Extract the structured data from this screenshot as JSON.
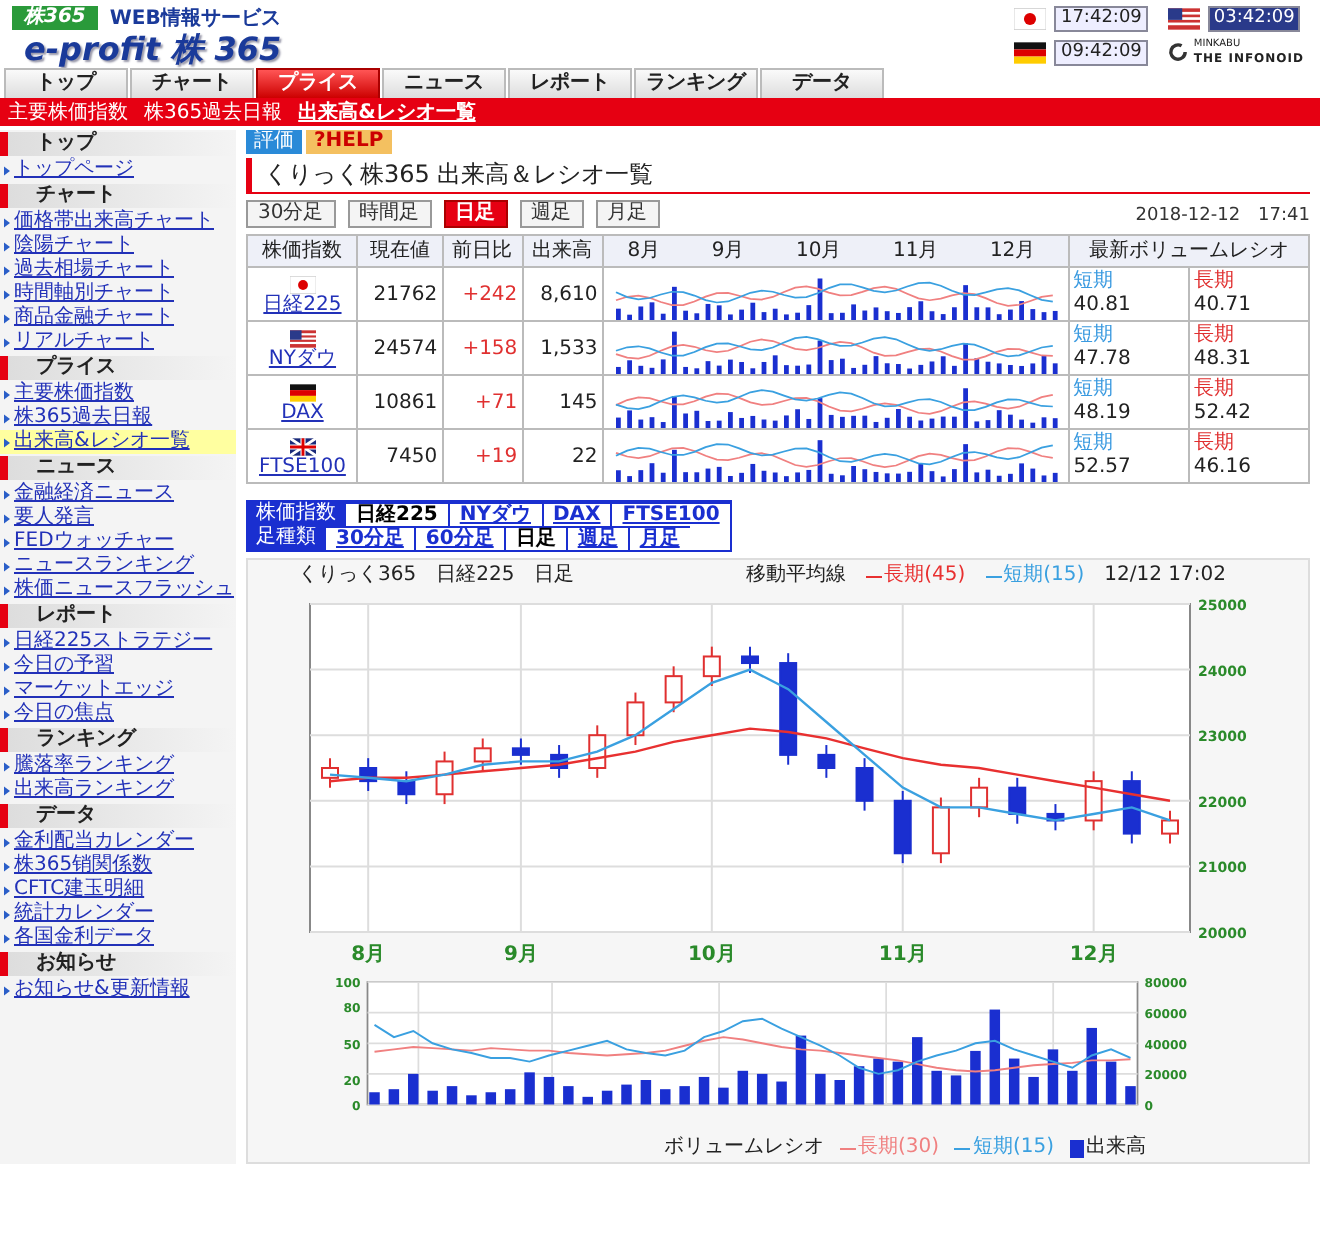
{
  "header": {
    "badge": "株365",
    "service": "WEB情報サービス",
    "logo": "e-profit 株 365",
    "clocks": [
      {
        "kind": "jp",
        "time": "17:42:09",
        "highlighted": false
      },
      {
        "kind": "us",
        "time": "03:42:09",
        "highlighted": true
      },
      {
        "kind": "de",
        "time": "09:42:09",
        "highlighted": false
      }
    ],
    "partner": {
      "small": "MINKABU",
      "name": "THE INFONOID"
    }
  },
  "nav": [
    {
      "label": "トップ",
      "selected": false
    },
    {
      "label": "チャート",
      "selected": false
    },
    {
      "label": "プライス",
      "selected": true
    },
    {
      "label": "ニュース",
      "selected": false
    },
    {
      "label": "レポート",
      "selected": false
    },
    {
      "label": "ランキング",
      "selected": false
    },
    {
      "label": "データ",
      "selected": false
    }
  ],
  "subnav": [
    {
      "label": "主要株価指数",
      "selected": false
    },
    {
      "label": "株365過去日報",
      "selected": false
    },
    {
      "label": "出来高&レシオ一覧",
      "selected": true
    }
  ],
  "sidebar": [
    {
      "title": "トップ",
      "items": [
        {
          "label": "トップページ",
          "selected": false
        }
      ]
    },
    {
      "title": "チャート",
      "items": [
        {
          "label": "価格帯出来高チャート",
          "selected": false
        },
        {
          "label": "陰陽チャート",
          "selected": false
        },
        {
          "label": "過去相場チャート",
          "selected": false
        },
        {
          "label": "時間軸別チャート",
          "selected": false
        },
        {
          "label": "商品金融チャート",
          "selected": false
        },
        {
          "label": "リアルチャート",
          "selected": false
        }
      ]
    },
    {
      "title": "プライス",
      "items": [
        {
          "label": "主要株価指数",
          "selected": false
        },
        {
          "label": "株365過去日報",
          "selected": false
        },
        {
          "label": "出来高&レシオ一覧",
          "selected": true
        }
      ]
    },
    {
      "title": "ニュース",
      "items": [
        {
          "label": "金融経済ニュース",
          "selected": false
        },
        {
          "label": "要人発言",
          "selected": false
        },
        {
          "label": "FEDウォッチャー",
          "selected": false
        },
        {
          "label": "ニュースランキング",
          "selected": false
        },
        {
          "label": "株価ニュースフラッシュ",
          "selected": false
        }
      ]
    },
    {
      "title": "レポート",
      "items": [
        {
          "label": "日経225ストラテジー",
          "selected": false
        },
        {
          "label": "今日の予習",
          "selected": false
        },
        {
          "label": "マーケットエッジ",
          "selected": false
        },
        {
          "label": "今日の焦点",
          "selected": false
        }
      ]
    },
    {
      "title": "ランキング",
      "items": [
        {
          "label": "騰落率ランキング",
          "selected": false
        },
        {
          "label": "出来高ランキング",
          "selected": false
        }
      ]
    },
    {
      "title": "データ",
      "items": [
        {
          "label": "金利配当カレンダー",
          "selected": false
        },
        {
          "label": "株365销関係数",
          "selected": false
        },
        {
          "label": "CFTC建玉明細",
          "selected": false
        },
        {
          "label": "統計カレンダー",
          "selected": false
        },
        {
          "label": "各国金利データ",
          "selected": false
        }
      ]
    },
    {
      "title": "お知らせ",
      "items": [
        {
          "label": "お知らせ&更新情報",
          "selected": false
        }
      ]
    }
  ],
  "tools": [
    {
      "label": "評価",
      "kind": "rate"
    },
    {
      "label": "?HELP",
      "kind": "help"
    }
  ],
  "title": "くりっく株365 出来高＆レシオ一覧",
  "periods": [
    {
      "label": "30分足",
      "selected": false
    },
    {
      "label": "時間足",
      "selected": false
    },
    {
      "label": "日足",
      "selected": true
    },
    {
      "label": "週足",
      "selected": false
    },
    {
      "label": "月足",
      "selected": false
    }
  ],
  "timestamp": "2018-12-12　17:41",
  "table": {
    "columns": [
      "株価指数",
      "現在値",
      "前日比",
      "出来高",
      "最新ボリュームレシオ"
    ],
    "months": [
      "8月",
      "9月",
      "10月",
      "11月",
      "12月"
    ],
    "rows": [
      {
        "kind": "jp",
        "name": "日経225",
        "price": "21762",
        "change": "+242",
        "volume": "8,610",
        "short_label": "短期",
        "short": "40.81",
        "long_label": "長期",
        "long": "40.71"
      },
      {
        "kind": "us",
        "name": "NYダウ",
        "price": "24574",
        "change": "+158",
        "volume": "1,533",
        "short_label": "短期",
        "short": "47.78",
        "long_label": "長期",
        "long": "48.31"
      },
      {
        "kind": "de",
        "name": "DAX",
        "price": "10861",
        "change": "+71",
        "volume": "145",
        "short_label": "短期",
        "short": "48.19",
        "long_label": "長期",
        "long": "52.42"
      },
      {
        "kind": "uk",
        "name": "FTSE100",
        "price": "7450",
        "change": "+19",
        "volume": "22",
        "short_label": "短期",
        "short": "52.57",
        "long_label": "長期",
        "long": "46.16"
      }
    ]
  },
  "selector": [
    {
      "label": "株価指数",
      "options": [
        {
          "label": "日経225",
          "selected": true
        },
        {
          "label": "NYダウ",
          "selected": false
        },
        {
          "label": "DAX",
          "selected": false
        },
        {
          "label": "FTSE100",
          "selected": false
        }
      ]
    },
    {
      "label": "足種類",
      "options": [
        {
          "label": "30分足",
          "selected": false
        },
        {
          "label": "60分足",
          "selected": false
        },
        {
          "label": "日足",
          "selected": true
        },
        {
          "label": "週足",
          "selected": false
        },
        {
          "label": "月足",
          "selected": false
        }
      ]
    }
  ],
  "chart_header": {
    "source": "くりっく365",
    "index": "日経225",
    "period": "日足",
    "ma_label": "移動平均線",
    "time": "12/12 17:02"
  },
  "price_chart": {
    "chart_data": {
      "type": "candlestick",
      "grid": true,
      "categories": [
        null,
        "8月",
        null,
        null,
        null,
        "9月",
        null,
        null,
        null,
        null,
        "10月",
        null,
        null,
        null,
        null,
        "11月",
        null,
        null,
        null,
        null,
        "12月",
        null,
        null
      ],
      "ylim": [
        20000,
        25000
      ],
      "yticks": [
        25000,
        24000,
        23000,
        22000,
        21000,
        20000
      ],
      "ohlc": [
        [
          22350,
          22650,
          22200,
          22500
        ],
        [
          22500,
          22650,
          22150,
          22300
        ],
        [
          22300,
          22450,
          21950,
          22100
        ],
        [
          22100,
          22750,
          21950,
          22600
        ],
        [
          22600,
          22950,
          22450,
          22800
        ],
        [
          22800,
          22950,
          22550,
          22700
        ],
        [
          22700,
          22850,
          22350,
          22500
        ],
        [
          22500,
          23150,
          22350,
          23000
        ],
        [
          23000,
          23650,
          22850,
          23500
        ],
        [
          23500,
          24050,
          23350,
          23900
        ],
        [
          23900,
          24350,
          23750,
          24200
        ],
        [
          24200,
          24350,
          23950,
          24100
        ],
        [
          24100,
          24250,
          22550,
          22700
        ],
        [
          22700,
          22850,
          22350,
          22500
        ],
        [
          22500,
          22650,
          21850,
          22000
        ],
        [
          22000,
          22150,
          21050,
          21200
        ],
        [
          21200,
          22050,
          21050,
          21900
        ],
        [
          21900,
          22350,
          21750,
          22200
        ],
        [
          22200,
          22350,
          21650,
          21800
        ],
        [
          21800,
          21950,
          21550,
          21700
        ],
        [
          21700,
          22450,
          21550,
          22300
        ],
        [
          22300,
          22450,
          21350,
          21500
        ],
        [
          21500,
          21850,
          21350,
          21700
        ]
      ],
      "series": [
        {
          "type": "line",
          "name": "長期(45)",
          "color": "#e83030",
          "values": [
            22300,
            22350,
            22350,
            22400,
            22450,
            22500,
            22550,
            22650,
            22750,
            22900,
            23000,
            23100,
            23050,
            22950,
            22800,
            22650,
            22550,
            22500,
            22400,
            22300,
            22200,
            22100,
            22000
          ]
        },
        {
          "type": "line",
          "name": "短期(15)",
          "color": "#3aa0e0",
          "values": [
            22400,
            22350,
            22300,
            22400,
            22550,
            22600,
            22600,
            22750,
            23000,
            23400,
            23800,
            24000,
            23700,
            23200,
            22700,
            22200,
            21900,
            21900,
            21800,
            21700,
            21800,
            21900,
            21700
          ]
        }
      ]
    }
  },
  "volume_chart": {
    "legend": "ボリュームレシオ",
    "chart_data": {
      "type": "bar",
      "grid": true,
      "ylim": [
        0,
        80000
      ],
      "yticks": [
        80000,
        60000,
        40000,
        20000,
        0
      ],
      "y2lim": [
        0,
        100
      ],
      "y2ticks": [
        100,
        80,
        50,
        20,
        0
      ],
      "series": [
        {
          "type": "bar",
          "name": "出来高",
          "color": "#1a2fd0",
          "values": [
            8000,
            10000,
            20000,
            9000,
            12000,
            6000,
            8000,
            10000,
            21000,
            18000,
            12000,
            5000,
            9000,
            13000,
            16000,
            10000,
            12000,
            18000,
            11000,
            22000,
            20000,
            15000,
            45000,
            20000,
            16000,
            25000,
            30000,
            28000,
            44000,
            22000,
            19000,
            35000,
            62000,
            30000,
            18000,
            36000,
            22000,
            50000,
            28000,
            12000
          ]
        },
        {
          "type": "line",
          "axis": "y2",
          "name": "長期(30)",
          "color": "#f08080",
          "values": [
            43,
            45,
            47,
            46,
            45,
            44,
            46,
            45,
            44,
            44,
            42,
            41,
            40,
            41,
            42,
            44,
            48,
            52,
            55,
            53,
            50,
            47,
            45,
            44,
            42,
            40,
            38,
            36,
            33,
            30,
            28,
            27,
            28,
            30,
            32,
            33,
            34,
            36,
            36,
            37
          ]
        },
        {
          "type": "line",
          "axis": "y2",
          "name": "短期(15)",
          "color": "#3aa0e0",
          "values": [
            65,
            55,
            60,
            50,
            45,
            42,
            38,
            38,
            35,
            40,
            44,
            48,
            52,
            45,
            42,
            40,
            44,
            55,
            60,
            68,
            70,
            62,
            55,
            48,
            40,
            30,
            25,
            28,
            35,
            40,
            44,
            50,
            52,
            45,
            40,
            35,
            30,
            40,
            45,
            38
          ]
        }
      ]
    }
  }
}
